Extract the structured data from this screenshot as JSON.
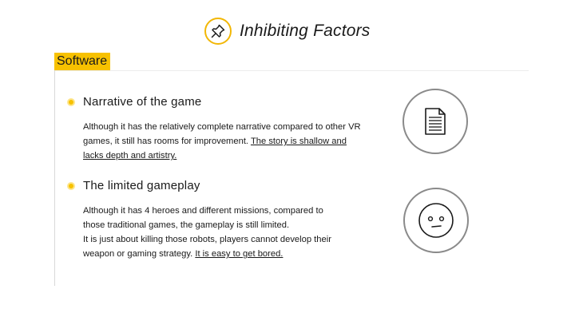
{
  "header": {
    "title": "Inhibiting Factors",
    "icon": "pushpin-icon",
    "accent_color": "#f2b705"
  },
  "section": {
    "label": "Software",
    "highlight_color": "#f7c100"
  },
  "points": [
    {
      "title": "Narrative of the game",
      "body_plain": "Although it has the relatively complete narrative compared to other VR games, it still has rooms for improvement. ",
      "body_underlined": "The story is shallow and lacks depth and artistry.",
      "icon": "document-icon"
    },
    {
      "title": "The limited gameplay",
      "body_line1": "Although it has 4 heroes and different missions, compared to those traditional games, the gameplay is still limited.",
      "body_plain": "It is just about killing those robots, players cannot develop their weapon or gaming strategy. ",
      "body_underlined": "It is easy to get bored.",
      "icon": "neutral-face-icon"
    }
  ]
}
